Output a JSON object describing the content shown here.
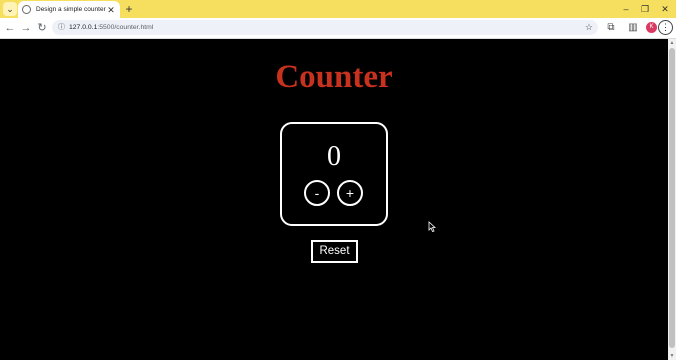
{
  "browser": {
    "tab_title": "Design a simple counter",
    "tab_close": "✕",
    "new_tab": "+",
    "url_host": "127.0.0.1",
    "url_path": ":5500/counter.html",
    "profile_initial": "K"
  },
  "page": {
    "heading": "Counter",
    "count": "0",
    "decrement_label": "-",
    "increment_label": "+",
    "reset_label": "Reset"
  },
  "colors": {
    "tab_strip": "#f6df5f",
    "heading": "#c8311e",
    "page_background": "#000000",
    "profile": "#d93a63"
  }
}
